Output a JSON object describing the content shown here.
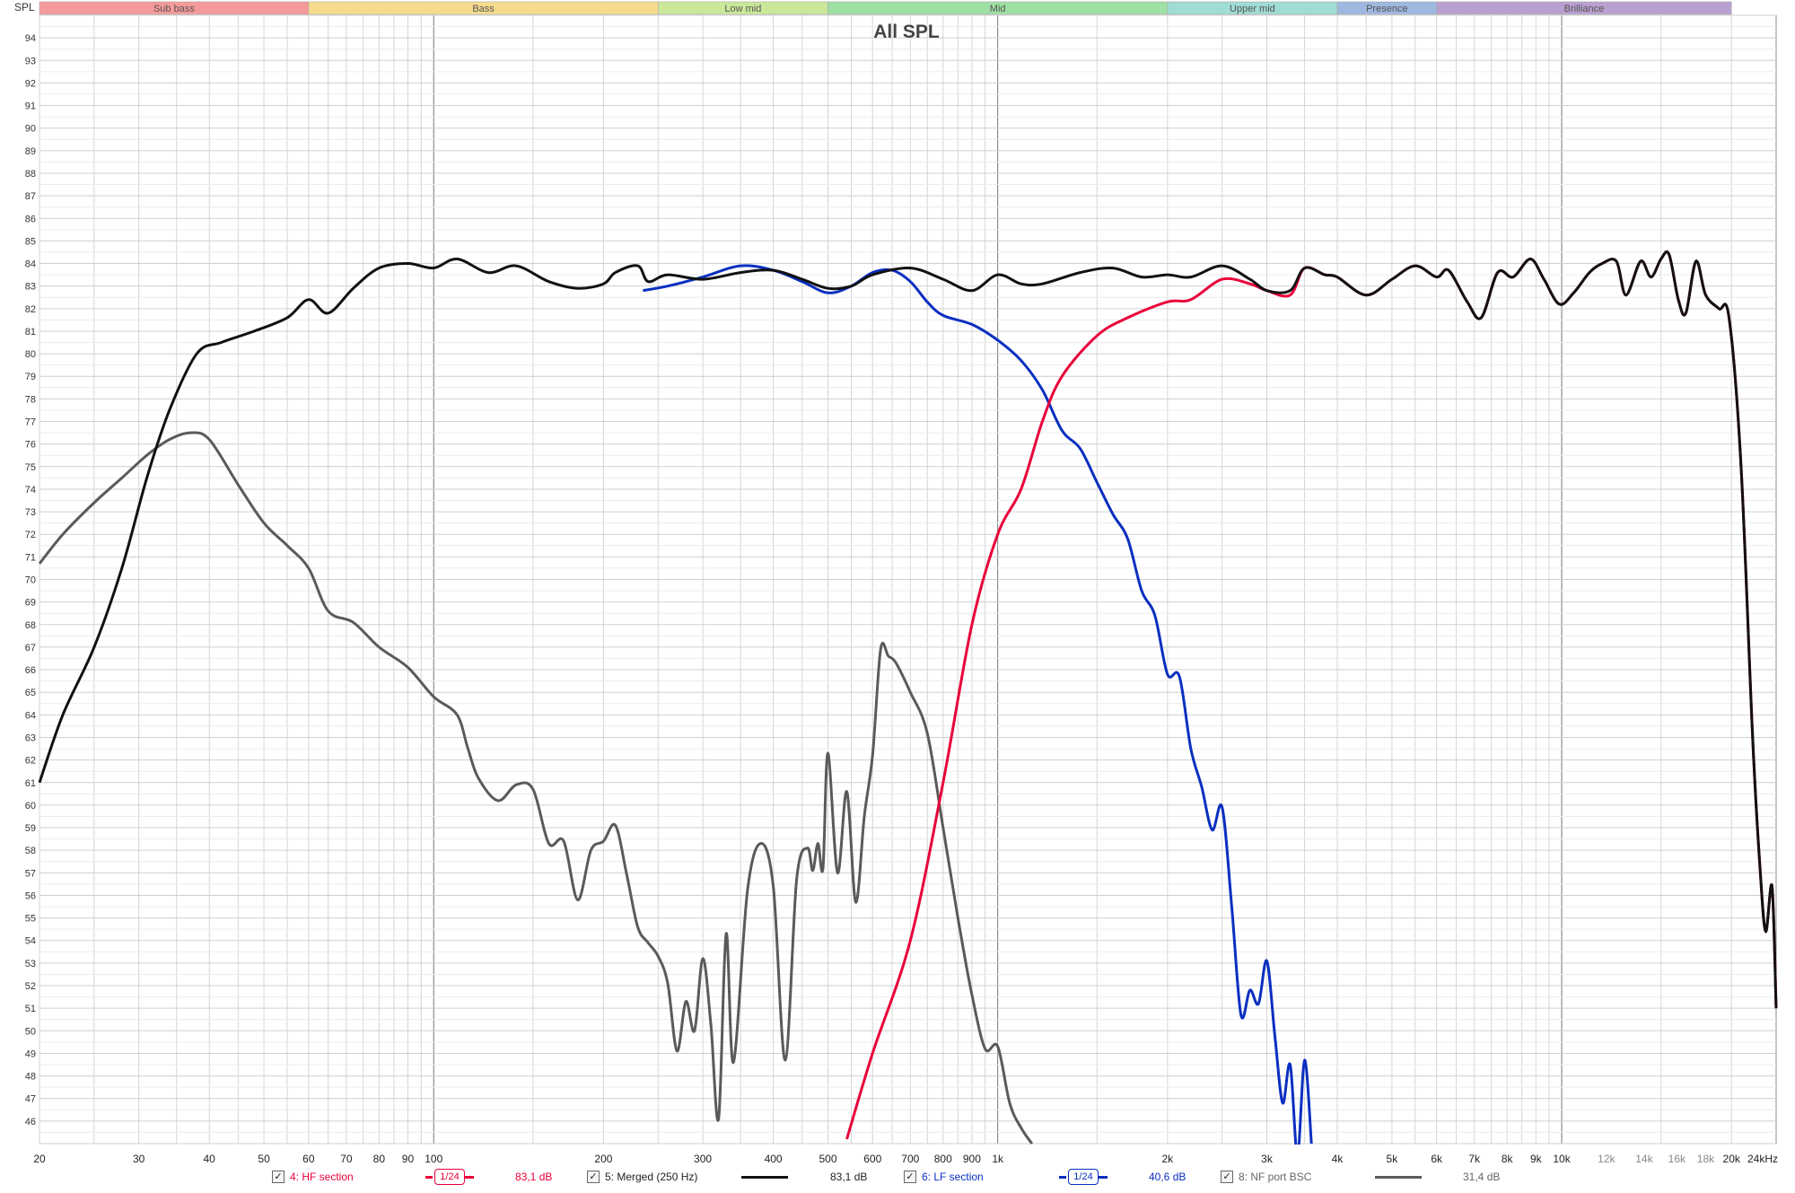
{
  "chart_data": {
    "type": "line",
    "title": "All SPL",
    "ylabel": "SPL",
    "x_unit_label": "kHz",
    "x_scale": "log",
    "xlim": [
      20,
      24000
    ],
    "ylim": [
      45,
      95
    ],
    "grid": true,
    "y_ticks": [
      46,
      47,
      48,
      49,
      50,
      51,
      52,
      53,
      54,
      55,
      56,
      57,
      58,
      59,
      60,
      61,
      62,
      63,
      64,
      65,
      66,
      67,
      68,
      69,
      70,
      71,
      72,
      73,
      74,
      75,
      76,
      77,
      78,
      79,
      80,
      81,
      82,
      83,
      84,
      85,
      86,
      87,
      88,
      89,
      90,
      91,
      92,
      93,
      94
    ],
    "x_ticks": [
      {
        "v": 20,
        "label": "20"
      },
      {
        "v": 30,
        "label": "30"
      },
      {
        "v": 40,
        "label": "40"
      },
      {
        "v": 50,
        "label": "50"
      },
      {
        "v": 60,
        "label": "60"
      },
      {
        "v": 70,
        "label": "70"
      },
      {
        "v": 80,
        "label": "80"
      },
      {
        "v": 90,
        "label": "90"
      },
      {
        "v": 100,
        "label": "100"
      },
      {
        "v": 200,
        "label": "200"
      },
      {
        "v": 300,
        "label": "300"
      },
      {
        "v": 400,
        "label": "400"
      },
      {
        "v": 500,
        "label": "500"
      },
      {
        "v": 600,
        "label": "600"
      },
      {
        "v": 700,
        "label": "700"
      },
      {
        "v": 800,
        "label": "800"
      },
      {
        "v": 900,
        "label": "900"
      },
      {
        "v": 1000,
        "label": "1k"
      },
      {
        "v": 2000,
        "label": "2k"
      },
      {
        "v": 3000,
        "label": "3k"
      },
      {
        "v": 4000,
        "label": "4k"
      },
      {
        "v": 5000,
        "label": "5k"
      },
      {
        "v": 6000,
        "label": "6k"
      },
      {
        "v": 7000,
        "label": "7k"
      },
      {
        "v": 8000,
        "label": "8k"
      },
      {
        "v": 9000,
        "label": "9k"
      },
      {
        "v": 10000,
        "label": "10k"
      },
      {
        "v": 12000,
        "label": "12k"
      },
      {
        "v": 14000,
        "label": "14k"
      },
      {
        "v": 16000,
        "label": "16k"
      },
      {
        "v": 18000,
        "label": "18k"
      },
      {
        "v": 20000,
        "label": "20k"
      },
      {
        "v": 24000,
        "label": "24kHz"
      }
    ],
    "bands": [
      {
        "name": "Sub bass",
        "from": 20,
        "to": 60,
        "color": "#f59a9a"
      },
      {
        "name": "Bass",
        "from": 60,
        "to": 250,
        "color": "#f7dc8e"
      },
      {
        "name": "Low mid",
        "from": 250,
        "to": 500,
        "color": "#cbe89a"
      },
      {
        "name": "Mid",
        "from": 500,
        "to": 2000,
        "color": "#9fe0a4"
      },
      {
        "name": "Upper mid",
        "from": 2000,
        "to": 4000,
        "color": "#9fdcd3"
      },
      {
        "name": "Presence",
        "from": 4000,
        "to": 6000,
        "color": "#9fb8e0"
      },
      {
        "name": "Brilliance",
        "from": 6000,
        "to": 20000,
        "color": "#b9a0d0"
      }
    ],
    "series": [
      {
        "name": "4: HF section",
        "color": "#e8003a",
        "smoothing": "1/24",
        "value_label": "83,1 dB",
        "points": [
          [
            540,
            45.2
          ],
          [
            600,
            49
          ],
          [
            700,
            54
          ],
          [
            800,
            61
          ],
          [
            900,
            68
          ],
          [
            1000,
            72
          ],
          [
            1100,
            74
          ],
          [
            1200,
            77
          ],
          [
            1300,
            79
          ],
          [
            1500,
            80.8
          ],
          [
            1700,
            81.6
          ],
          [
            2000,
            82.3
          ],
          [
            2200,
            82.4
          ],
          [
            2500,
            83.3
          ],
          [
            2800,
            83.1
          ],
          [
            3000,
            82.8
          ],
          [
            3300,
            82.6
          ],
          [
            3500,
            83.8
          ],
          [
            3800,
            83.5
          ],
          [
            4000,
            83.4
          ],
          [
            4500,
            82.6
          ],
          [
            5000,
            83.3
          ],
          [
            5500,
            83.9
          ],
          [
            6000,
            83.4
          ],
          [
            6300,
            83.7
          ],
          [
            6800,
            82.3
          ],
          [
            7200,
            81.6
          ],
          [
            7700,
            83.6
          ],
          [
            8200,
            83.4
          ],
          [
            8800,
            84.2
          ],
          [
            9300,
            83.3
          ],
          [
            9900,
            82.2
          ],
          [
            10500,
            82.7
          ],
          [
            11200,
            83.6
          ],
          [
            11800,
            84.0
          ],
          [
            12500,
            84.1
          ],
          [
            13000,
            82.6
          ],
          [
            13800,
            84.1
          ],
          [
            14400,
            83.4
          ],
          [
            15000,
            84.2
          ],
          [
            15500,
            84.4
          ],
          [
            16100,
            82.4
          ],
          [
            16600,
            81.8
          ],
          [
            17300,
            84.1
          ],
          [
            18000,
            82.6
          ],
          [
            19000,
            82.0
          ],
          [
            19800,
            81.6
          ],
          [
            20800,
            75
          ],
          [
            21800,
            63
          ],
          [
            22500,
            57
          ],
          [
            23000,
            54.4
          ],
          [
            23600,
            56.4
          ],
          [
            24000,
            51
          ]
        ]
      },
      {
        "name": "5: Merged (250 Hz)",
        "color": "#111111",
        "smoothing": "",
        "value_label": "83,1 dB",
        "points": [
          [
            20,
            61
          ],
          [
            22,
            64
          ],
          [
            25,
            67
          ],
          [
            28,
            70.5
          ],
          [
            31,
            74.5
          ],
          [
            34,
            77.5
          ],
          [
            38,
            80
          ],
          [
            42,
            80.5
          ],
          [
            48,
            81
          ],
          [
            55,
            81.6
          ],
          [
            60,
            82.4
          ],
          [
            65,
            81.8
          ],
          [
            72,
            82.9
          ],
          [
            80,
            83.8
          ],
          [
            90,
            84.0
          ],
          [
            100,
            83.8
          ],
          [
            110,
            84.2
          ],
          [
            125,
            83.6
          ],
          [
            140,
            83.9
          ],
          [
            160,
            83.2
          ],
          [
            180,
            82.9
          ],
          [
            200,
            83.1
          ],
          [
            210,
            83.6
          ],
          [
            230,
            83.9
          ],
          [
            240,
            83.2
          ],
          [
            260,
            83.5
          ],
          [
            300,
            83.3
          ],
          [
            350,
            83.6
          ],
          [
            400,
            83.7
          ],
          [
            450,
            83.3
          ],
          [
            500,
            82.9
          ],
          [
            550,
            83.0
          ],
          [
            600,
            83.5
          ],
          [
            700,
            83.8
          ],
          [
            800,
            83.3
          ],
          [
            900,
            82.8
          ],
          [
            1000,
            83.5
          ],
          [
            1100,
            83.1
          ],
          [
            1200,
            83.1
          ],
          [
            1400,
            83.6
          ],
          [
            1600,
            83.8
          ],
          [
            1800,
            83.4
          ],
          [
            2000,
            83.5
          ],
          [
            2200,
            83.4
          ],
          [
            2500,
            83.9
          ],
          [
            2800,
            83.3
          ],
          [
            3000,
            82.8
          ],
          [
            3300,
            82.8
          ],
          [
            3500,
            83.8
          ],
          [
            3800,
            83.5
          ],
          [
            4000,
            83.4
          ],
          [
            4500,
            82.6
          ],
          [
            5000,
            83.3
          ],
          [
            5500,
            83.9
          ],
          [
            6000,
            83.4
          ],
          [
            6300,
            83.7
          ],
          [
            6800,
            82.3
          ],
          [
            7200,
            81.6
          ],
          [
            7700,
            83.6
          ],
          [
            8200,
            83.4
          ],
          [
            8800,
            84.2
          ],
          [
            9300,
            83.3
          ],
          [
            9900,
            82.2
          ],
          [
            10500,
            82.7
          ],
          [
            11200,
            83.6
          ],
          [
            11800,
            84.0
          ],
          [
            12500,
            84.1
          ],
          [
            13000,
            82.6
          ],
          [
            13800,
            84.1
          ],
          [
            14400,
            83.4
          ],
          [
            15000,
            84.2
          ],
          [
            15500,
            84.4
          ],
          [
            16100,
            82.4
          ],
          [
            16600,
            81.8
          ],
          [
            17300,
            84.1
          ],
          [
            18000,
            82.6
          ],
          [
            19000,
            82.0
          ],
          [
            19800,
            81.6
          ],
          [
            20800,
            75
          ],
          [
            21800,
            63
          ],
          [
            22500,
            57
          ],
          [
            23000,
            54.4
          ],
          [
            23600,
            56.4
          ],
          [
            24000,
            51
          ]
        ]
      },
      {
        "name": "6: LF section",
        "color": "#0a2fc0",
        "smoothing": "1/24",
        "value_label": "40,6 dB",
        "points": [
          [
            235,
            82.8
          ],
          [
            260,
            83.0
          ],
          [
            300,
            83.4
          ],
          [
            350,
            83.9
          ],
          [
            400,
            83.7
          ],
          [
            450,
            83.2
          ],
          [
            500,
            82.7
          ],
          [
            550,
            83.0
          ],
          [
            600,
            83.6
          ],
          [
            650,
            83.7
          ],
          [
            700,
            83.2
          ],
          [
            750,
            82.3
          ],
          [
            800,
            81.7
          ],
          [
            900,
            81.3
          ],
          [
            1000,
            80.6
          ],
          [
            1100,
            79.7
          ],
          [
            1200,
            78.4
          ],
          [
            1300,
            76.6
          ],
          [
            1400,
            75.8
          ],
          [
            1500,
            74.3
          ],
          [
            1600,
            72.9
          ],
          [
            1700,
            71.8
          ],
          [
            1800,
            69.5
          ],
          [
            1900,
            68.4
          ],
          [
            2000,
            65.8
          ],
          [
            2100,
            65.7
          ],
          [
            2200,
            62.5
          ],
          [
            2300,
            60.8
          ],
          [
            2400,
            58.9
          ],
          [
            2500,
            59.9
          ],
          [
            2600,
            55.5
          ],
          [
            2700,
            50.7
          ],
          [
            2800,
            51.8
          ],
          [
            2900,
            51.2
          ],
          [
            3000,
            53.1
          ],
          [
            3100,
            49.8
          ],
          [
            3200,
            46.8
          ],
          [
            3300,
            48.5
          ],
          [
            3400,
            44.5
          ],
          [
            3500,
            48.7
          ],
          [
            3600,
            45.0
          ]
        ]
      },
      {
        "name": "8: NF port BSC",
        "color": "#5a5a5a",
        "smoothing": "",
        "value_label": "31,4 dB",
        "points": [
          [
            20,
            70.7
          ],
          [
            22,
            72
          ],
          [
            25,
            73.4
          ],
          [
            28,
            74.5
          ],
          [
            31,
            75.5
          ],
          [
            34,
            76.2
          ],
          [
            37,
            76.5
          ],
          [
            40,
            76.2
          ],
          [
            45,
            74.2
          ],
          [
            50,
            72.5
          ],
          [
            55,
            71.5
          ],
          [
            60,
            70.5
          ],
          [
            65,
            68.6
          ],
          [
            72,
            68.1
          ],
          [
            80,
            67
          ],
          [
            90,
            66.1
          ],
          [
            100,
            64.8
          ],
          [
            110,
            64.0
          ],
          [
            115,
            62.5
          ],
          [
            120,
            61.2
          ],
          [
            130,
            60.2
          ],
          [
            140,
            60.9
          ],
          [
            150,
            60.7
          ],
          [
            160,
            58.3
          ],
          [
            170,
            58.4
          ],
          [
            180,
            55.8
          ],
          [
            190,
            58.0
          ],
          [
            200,
            58.4
          ],
          [
            210,
            59.1
          ],
          [
            220,
            56.9
          ],
          [
            230,
            54.6
          ],
          [
            240,
            53.9
          ],
          [
            250,
            53.3
          ],
          [
            260,
            52.1
          ],
          [
            270,
            49.1
          ],
          [
            280,
            51.3
          ],
          [
            290,
            50.0
          ],
          [
            300,
            53.2
          ],
          [
            310,
            50.3
          ],
          [
            320,
            46.1
          ],
          [
            330,
            54.3
          ],
          [
            340,
            48.6
          ],
          [
            360,
            56.2
          ],
          [
            380,
            58.3
          ],
          [
            400,
            56.4
          ],
          [
            420,
            48.7
          ],
          [
            440,
            56.7
          ],
          [
            460,
            58.1
          ],
          [
            470,
            57.1
          ],
          [
            480,
            58.3
          ],
          [
            490,
            57.2
          ],
          [
            500,
            62.3
          ],
          [
            520,
            57.0
          ],
          [
            540,
            60.6
          ],
          [
            560,
            55.7
          ],
          [
            580,
            59.5
          ],
          [
            600,
            62.2
          ],
          [
            620,
            66.9
          ],
          [
            640,
            66.6
          ],
          [
            660,
            66.3
          ],
          [
            700,
            65.0
          ],
          [
            750,
            63.2
          ],
          [
            800,
            59.0
          ],
          [
            850,
            55.0
          ],
          [
            900,
            51.6
          ],
          [
            950,
            49.2
          ],
          [
            1000,
            49.3
          ],
          [
            1050,
            46.8
          ],
          [
            1100,
            45.7
          ],
          [
            1150,
            45.0
          ]
        ]
      }
    ],
    "legend_position": "bottom"
  }
}
